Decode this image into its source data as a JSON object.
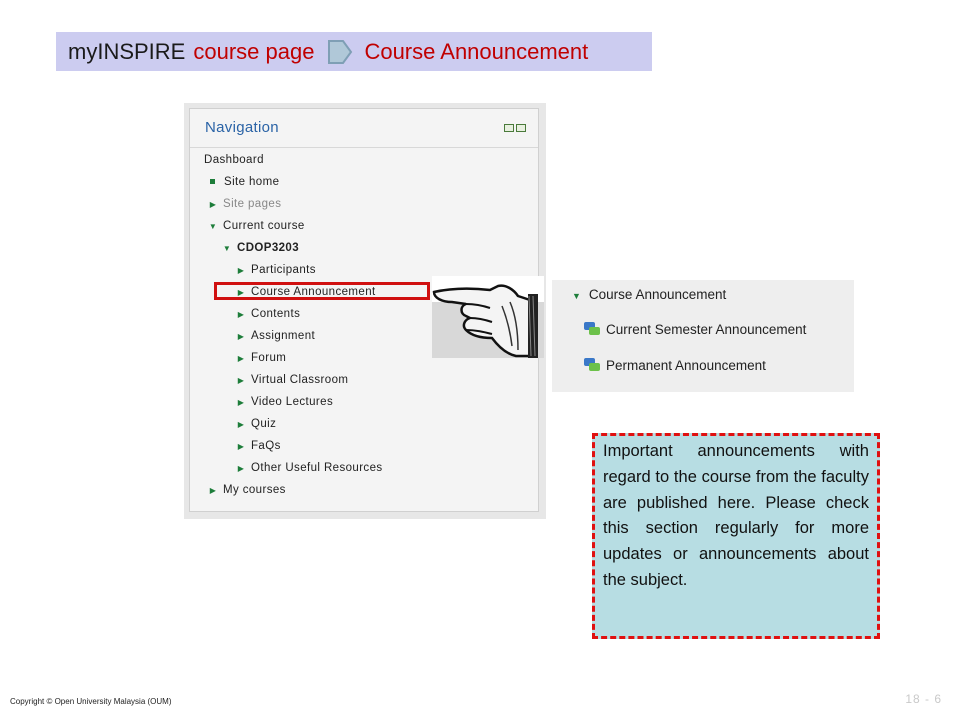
{
  "banner": {
    "part1": "myINSPIRE",
    "part2": "course page",
    "part3": "Course Announcement"
  },
  "navigation": {
    "title": "Navigation",
    "items": [
      {
        "label": "Dashboard"
      },
      {
        "label": "Site home"
      },
      {
        "label": "Site pages"
      },
      {
        "label": "Current course"
      },
      {
        "label": "CDOP3203"
      },
      {
        "label": "Participants"
      },
      {
        "label": "Course Announcement"
      },
      {
        "label": "Contents"
      },
      {
        "label": "Assignment"
      },
      {
        "label": "Forum"
      },
      {
        "label": "Virtual Classroom"
      },
      {
        "label": "Video Lectures"
      },
      {
        "label": "Quiz"
      },
      {
        "label": "FaQs"
      },
      {
        "label": "Other Useful Resources"
      },
      {
        "label": "My courses"
      }
    ]
  },
  "announcement_panel": {
    "heading": "Course Announcement",
    "items": [
      {
        "label": "Current Semester Announcement"
      },
      {
        "label": "Permanent Announcement"
      }
    ]
  },
  "callout": {
    "text": "Important announcements with regard to the course from the faculty are published here. Please check this section regularly for more updates or announcements about the subject."
  },
  "footer": {
    "copyright": "Copyright © Open University Malaysia (OUM)",
    "page": "18 - 6"
  },
  "colors": {
    "banner_bg": "#ccccf0",
    "accent_red": "#c00000",
    "nav_title": "#2a63a6",
    "callout_bg": "#b7dde3",
    "icon_green": "#1d7d3a"
  }
}
